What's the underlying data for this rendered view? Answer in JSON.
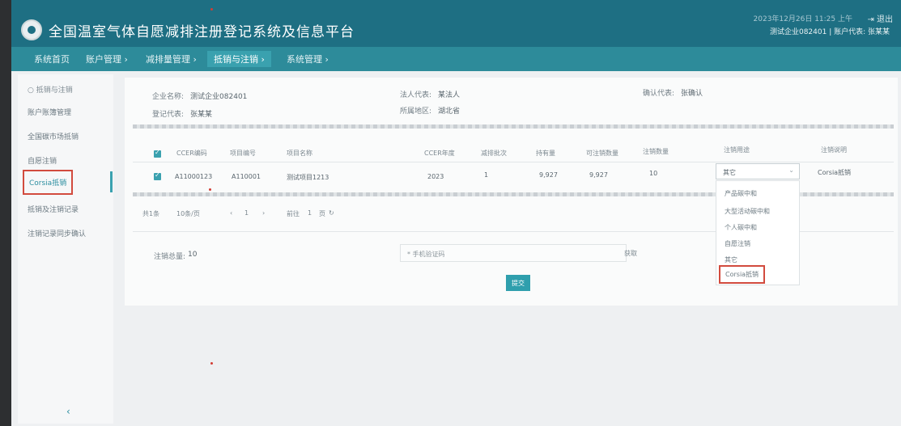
{
  "header": {
    "title": "全国温室气体自愿减排注册登记系统及信息平台",
    "datetime": "2023年12月26日 11:25 上午",
    "logout": "退出",
    "account": "测试企业082401 | 账户代表: 张某某"
  },
  "nav": {
    "items": [
      {
        "label": "系统首页"
      },
      {
        "label": "账户管理 ›"
      },
      {
        "label": "减排量管理 ›"
      },
      {
        "label": "抵销与注销 ›"
      },
      {
        "label": "系统管理 ›"
      }
    ]
  },
  "sidebar": {
    "group": "抵销与注销",
    "items": [
      {
        "label": "账户账簿管理"
      },
      {
        "label": "全国碳市场抵销"
      },
      {
        "label": "自愿注销"
      },
      {
        "label": "Corsia抵销"
      },
      {
        "label": "抵销及注销记录"
      },
      {
        "label": "注销记录同步确认"
      }
    ],
    "collapse": "‹"
  },
  "info": {
    "company_label": "企业名称:",
    "company_value": "测试企业082401",
    "legal_label": "法人代表:",
    "legal_value": "某法人",
    "confirm_label": "确认代表:",
    "confirm_value": "张确认",
    "register_label": "登记代表:",
    "register_value": "张某某",
    "region_label": "所属地区:",
    "region_value": "湖北省"
  },
  "table": {
    "columns": [
      "CCER编码",
      "项目编号",
      "项目名称",
      "CCER年度",
      "减排批次",
      "持有量",
      "可注销数量",
      "注销数量",
      "注销用途",
      "注销说明"
    ],
    "rows": [
      {
        "ccer": "A11000123",
        "project_no": "A110001",
        "project_name": "测试项目1213",
        "year": "2023",
        "batch": "1",
        "holding": "9,927",
        "available": "9,927",
        "quantity": "10",
        "purpose": "其它",
        "desc": "Corsia抵销"
      }
    ]
  },
  "pager": {
    "total": "共1条",
    "per_page": "10条/页",
    "prev": "‹",
    "current": "1",
    "next": "›",
    "goto_label": "前往",
    "goto_page": "1",
    "page_suffix": "页",
    "refresh": "↻"
  },
  "dropdown": {
    "options": [
      "产品碳中和",
      "大型活动碳中和",
      "个人碳中和",
      "自愿注销",
      "其它",
      "Corsia抵销"
    ],
    "highlighted_index": 5
  },
  "form": {
    "quantity_label": "注销总量:",
    "quantity_value": "10",
    "phone_placeholder": "* 手机验证码",
    "get_code": "获取",
    "submit": "提交"
  }
}
